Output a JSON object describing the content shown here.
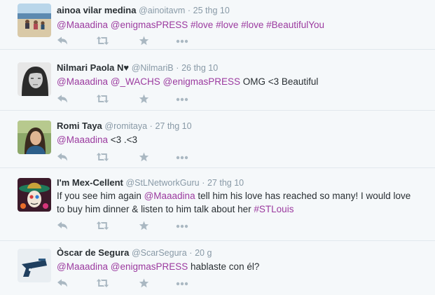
{
  "colors": {
    "link": "#9b3a9f",
    "meta": "#8899a6",
    "action": "#aab8c2",
    "text": "#292f33",
    "bg": "#f5f8fa"
  },
  "tweets": [
    {
      "fullname": "ainoa vilar medina",
      "username": "@ainoitavm",
      "sep": "·",
      "time": "25 thg 10",
      "avatar_icon": "beach-photo-avatar",
      "text": [
        {
          "t": "@Maaadina",
          "k": "mention"
        },
        {
          "t": " ",
          "k": "plain"
        },
        {
          "t": "@enigmasPRESS",
          "k": "mention"
        },
        {
          "t": "  ",
          "k": "plain"
        },
        {
          "t": "#love",
          "k": "hashtag"
        },
        {
          "t": " ",
          "k": "plain"
        },
        {
          "t": "#love",
          "k": "hashtag"
        },
        {
          "t": " ",
          "k": "plain"
        },
        {
          "t": "#love",
          "k": "hashtag"
        },
        {
          "t": " ",
          "k": "plain"
        },
        {
          "t": "#BeautifulYou",
          "k": "hashtag"
        }
      ]
    },
    {
      "fullname": "Nilmari Paola N♥",
      "username": "@NilmariB",
      "sep": "·",
      "time": "26 thg 10",
      "avatar_icon": "portrait-bw-avatar",
      "text": [
        {
          "t": "@Maaadina",
          "k": "mention"
        },
        {
          "t": " ",
          "k": "plain"
        },
        {
          "t": "@_WACHS",
          "k": "mention"
        },
        {
          "t": " ",
          "k": "plain"
        },
        {
          "t": "@enigmasPRESS",
          "k": "mention"
        },
        {
          "t": " OMG <3 Beautiful",
          "k": "plain"
        }
      ]
    },
    {
      "fullname": "Romi Taya",
      "username": "@romitaya",
      "sep": "·",
      "time": "27 thg 10",
      "avatar_icon": "portrait-outdoor-avatar",
      "text": [
        {
          "t": "@Maaadina",
          "k": "mention"
        },
        {
          "t": " <3 .<3",
          "k": "plain"
        }
      ]
    },
    {
      "fullname": "I'm Mex-Cellent",
      "username": "@StLNetworkGuru",
      "sep": "·",
      "time": "27 thg 10",
      "avatar_icon": "sombrero-skull-avatar",
      "text": [
        {
          "t": "If you see him again ",
          "k": "plain"
        },
        {
          "t": "@Maaadina",
          "k": "mention"
        },
        {
          "t": " tell him his love has reached so many! I would love to buy him dinner & listen to him talk about her ",
          "k": "plain"
        },
        {
          "t": "#STLouis",
          "k": "hashtag"
        }
      ]
    },
    {
      "fullname": "Òscar de Segura",
      "username": "@ScarSegura",
      "sep": "·",
      "time": "20 g",
      "avatar_icon": "handgun-avatar",
      "text": [
        {
          "t": "@Maaadina",
          "k": "mention"
        },
        {
          "t": " ",
          "k": "plain"
        },
        {
          "t": "@enigmasPRESS",
          "k": "mention"
        },
        {
          "t": " hablaste con él?",
          "k": "plain"
        }
      ]
    }
  ],
  "action_icons": [
    "reply-icon",
    "retweet-icon",
    "favorite-icon",
    "more-icon"
  ]
}
